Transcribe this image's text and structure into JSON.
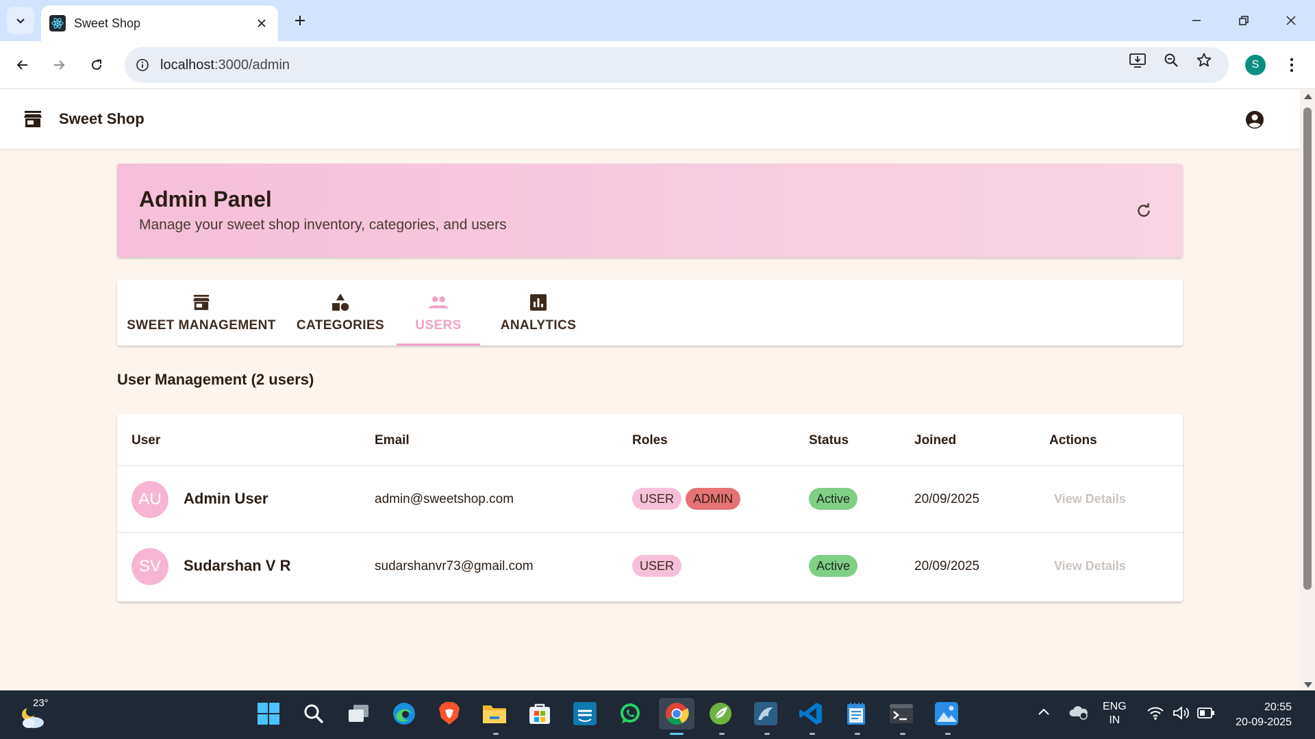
{
  "browser": {
    "tab_title": "Sweet Shop",
    "url_host": "localhost",
    "url_path": ":3000/admin",
    "profile_initial": "S"
  },
  "app": {
    "brand": "Sweet Shop"
  },
  "hero": {
    "title": "Admin Panel",
    "subtitle": "Manage your sweet shop inventory, categories, and users"
  },
  "tabs": [
    {
      "label": "SWEET MANAGEMENT",
      "icon": "store-icon",
      "active": false
    },
    {
      "label": "CATEGORIES",
      "icon": "category-shapes-icon",
      "active": false
    },
    {
      "label": "USERS",
      "icon": "people-icon",
      "active": true
    },
    {
      "label": "ANALYTICS",
      "icon": "bar-chart-icon",
      "active": false
    }
  ],
  "section_title": "User Management (2 users)",
  "table": {
    "headers": [
      "User",
      "Email",
      "Roles",
      "Status",
      "Joined",
      "Actions"
    ],
    "rows": [
      {
        "initials": "AU",
        "name": "Admin User",
        "email": "admin@sweetshop.com",
        "roles": [
          "USER",
          "ADMIN"
        ],
        "status": "Active",
        "joined": "20/09/2025",
        "action": "View Details"
      },
      {
        "initials": "SV",
        "name": "Sudarshan V R",
        "email": "sudarshanvr73@gmail.com",
        "roles": [
          "USER"
        ],
        "status": "Active",
        "joined": "20/09/2025",
        "action": "View Details"
      }
    ]
  },
  "taskbar": {
    "temperature": "23°",
    "lang_line1": "ENG",
    "lang_line2": "IN",
    "time": "20:55",
    "date": "20-09-2025"
  },
  "colors": {
    "accent_pink": "#f2a0c8",
    "admin_chip": "#e57373",
    "active_chip": "#7fcf85",
    "page_bg": "#fdf4ee"
  }
}
